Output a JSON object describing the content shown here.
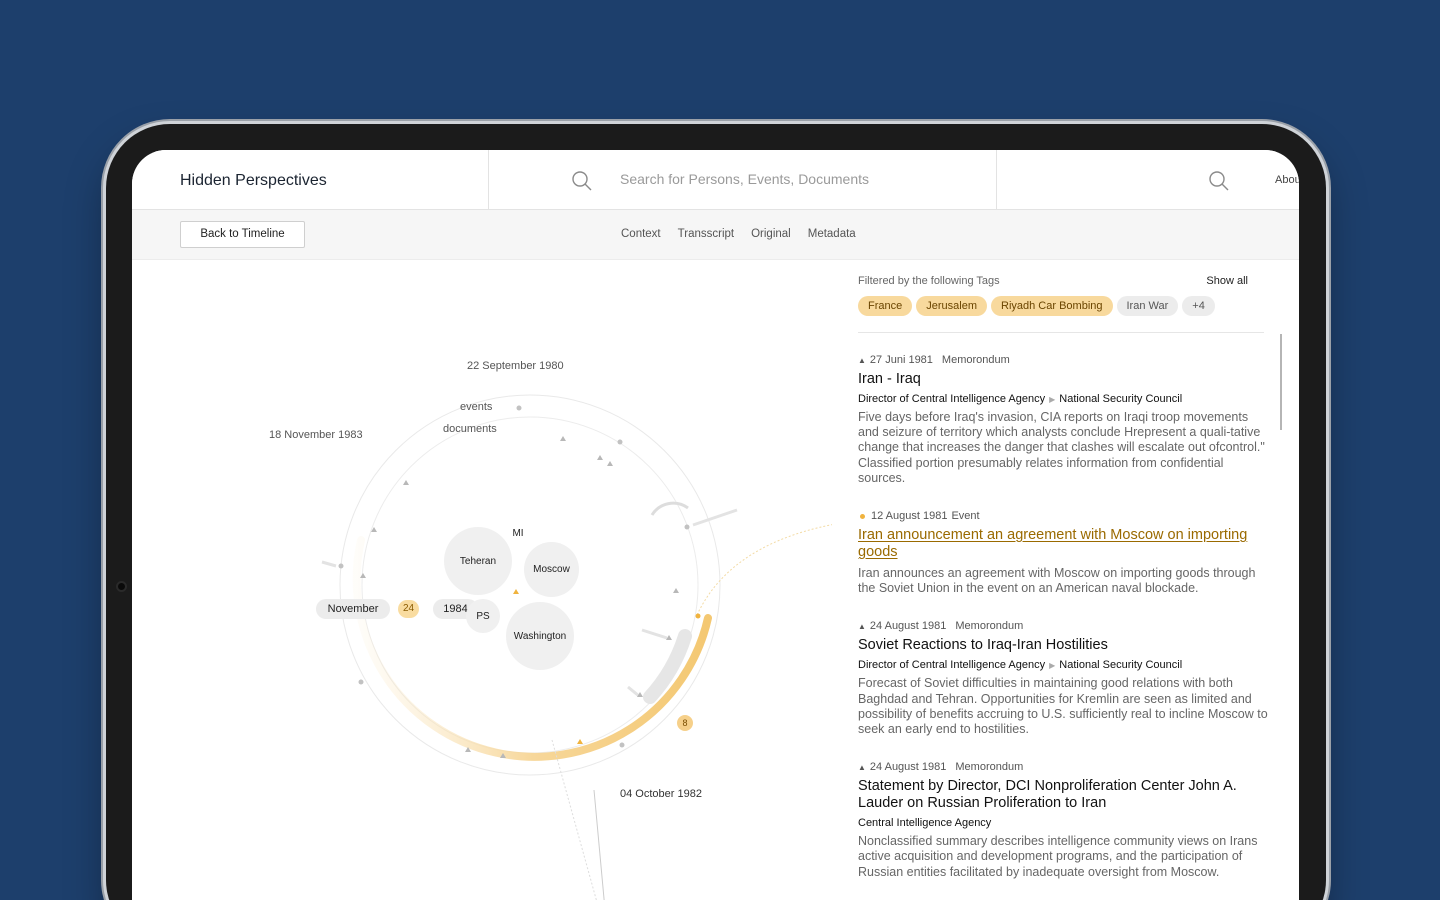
{
  "app": {
    "title": "Hidden Perspectives",
    "search_placeholder": "Search for Persons, Events, Documents",
    "about_label": "About"
  },
  "toolbar": {
    "back_label": "Back to Timeline",
    "tabs": [
      "Context",
      "Transscript",
      "Original",
      "Metadata"
    ]
  },
  "visualization": {
    "date_top": "22 September 1980",
    "date_left": "18 November 1983",
    "date_bottom": "04 October 1982",
    "ring_label_events": "events",
    "ring_label_documents": "documents",
    "month_label": "November",
    "day_label": "24",
    "year_label": "1984",
    "count_badge": "8",
    "locations": [
      "Teheran",
      "Moscow",
      "PS",
      "Washington",
      "MI"
    ]
  },
  "filters": {
    "heading": "Filtered by the following Tags",
    "show_all_label": "Show all",
    "tags": [
      {
        "label": "France",
        "active": true
      },
      {
        "label": "Jerusalem",
        "active": true
      },
      {
        "label": "Riyadh Car Bombing",
        "active": true
      },
      {
        "label": "Iran War",
        "active": false
      },
      {
        "label": "+4",
        "active": false
      }
    ]
  },
  "entries": [
    {
      "date": "27 Juni 1981",
      "type": "Memorondum",
      "title": "Iran - Iraq",
      "from": "Director of Central Intelligence Agency",
      "to": "National Security Council",
      "description": "Five days before Iraq's invasion, CIA reports on Iraqi troop movements and seizure of territory which analysts conclude Hrepresent a quali-tative change that increases the danger that clashes will escalate out ofcontrol.\" Classified portion presumably relates information from confidential sources."
    },
    {
      "date": "12 August 1981",
      "type": "Event",
      "title": "Iran announcement an agreement with Moscow on importing goods",
      "from": "",
      "to": "",
      "description": "Iran announces an agreement with Moscow on importing goods through the Soviet Union in the event on an American naval blockade."
    },
    {
      "date": "24 August 1981",
      "type": "Memorondum",
      "title": "Soviet Reactions to Iraq-Iran Hostilities",
      "from": "Director of Central Intelligence Agency",
      "to": "National Security Council",
      "description": "Forecast of Soviet difficulties in maintaining good relations with both Baghdad and Tehran. Opportunities for Kremlin are seen as limited and possibility of benefits accruing to U.S. sufficiently real to incline Moscow to seek an early end to hostilities."
    },
    {
      "date": "24 August 1981",
      "type": "Memorondum",
      "title": "Statement by Director, DCI Nonproliferation Center John A. Lauder on Russian Proliferation to Iran",
      "from": "Central Intelligence Agency",
      "to": "",
      "description": "Nonclassified summary describes intelligence community views on Irans active acquisition and development programs, and the participation of Russian entities facilitated by inadequate oversight from Moscow."
    }
  ],
  "colors": {
    "background": "#1d3f6c",
    "accent": "#f0b33e",
    "tag_active": "#f8d99d",
    "link": "#9a6a00"
  }
}
